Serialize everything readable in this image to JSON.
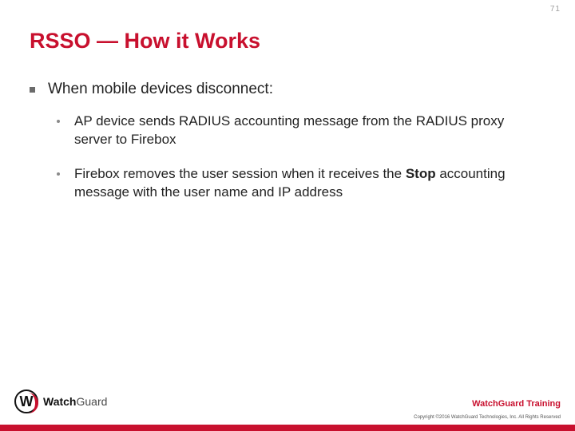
{
  "page_number": "71",
  "title": "RSSO — How it Works",
  "main_bullet": "When mobile devices disconnect:",
  "sub_bullets": [
    {
      "pre": "AP device sends RADIUS accounting message from the RADIUS proxy server to Firebox",
      "bold": "",
      "post": ""
    },
    {
      "pre": "Firebox removes the user session when it receives the ",
      "bold": "Stop",
      "post": " accounting message with the user name and IP address"
    }
  ],
  "logo": {
    "mark": "W",
    "brand_bold": "Watch",
    "brand_rest": "Guard"
  },
  "training_label": "WatchGuard Training",
  "copyright": "Copyright ©2016 WatchGuard Technologies, Inc. All Rights Reserved"
}
